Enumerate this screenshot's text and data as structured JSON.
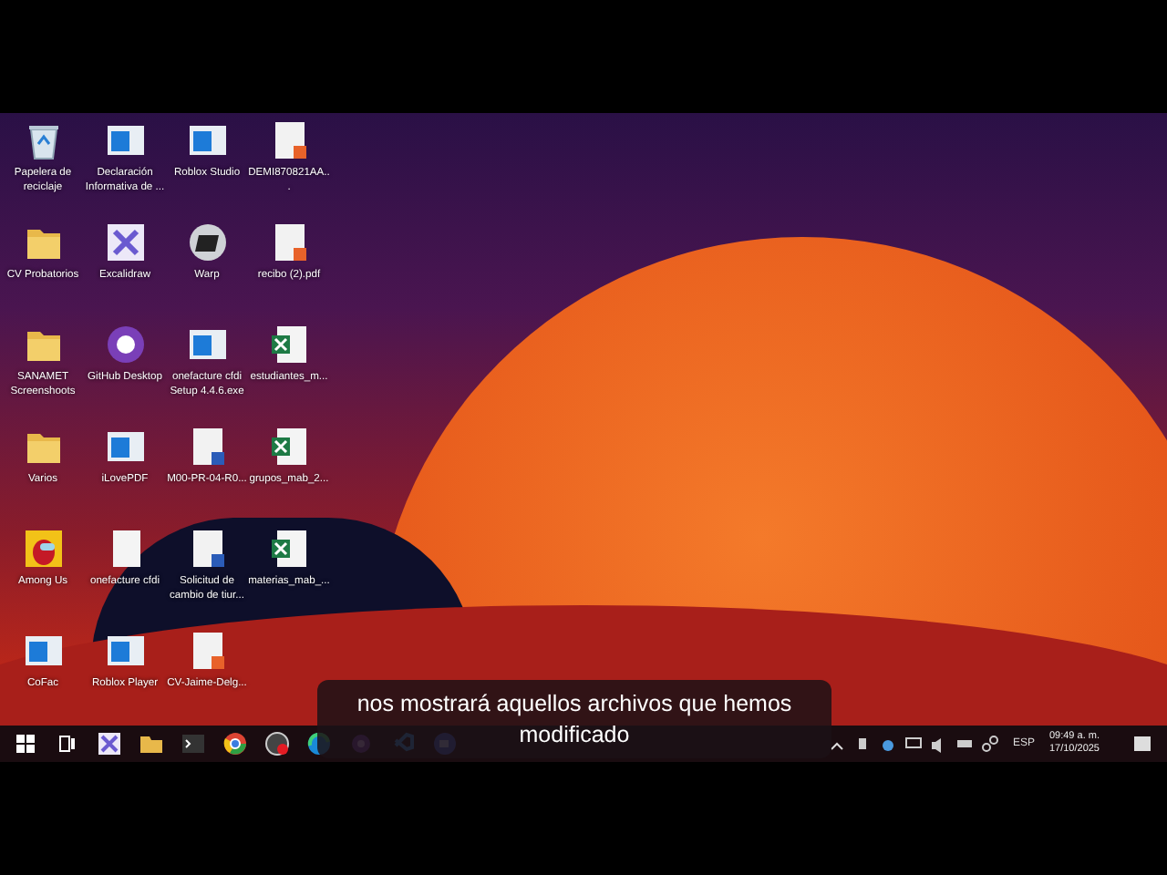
{
  "desktop_icons": [
    {
      "kind": "recycle",
      "label": "Papelera de reciclaje"
    },
    {
      "kind": "app",
      "label": "Declaración Informativa de ..."
    },
    {
      "kind": "app",
      "label": "Roblox Studio"
    },
    {
      "kind": "pdf",
      "label": "DEMI870821AA..."
    },
    {
      "kind": "folder",
      "label": "CV Probatorios"
    },
    {
      "kind": "excalidraw",
      "label": "Excalidraw"
    },
    {
      "kind": "warp",
      "label": "Warp"
    },
    {
      "kind": "pdf",
      "label": "recibo (2).pdf"
    },
    {
      "kind": "folder",
      "label": "SANAMET Screenshoots"
    },
    {
      "kind": "github",
      "label": "GitHub Desktop"
    },
    {
      "kind": "app",
      "label": "onefacture cfdi Setup 4.4.6.exe"
    },
    {
      "kind": "excel",
      "label": "estudiantes_m..."
    },
    {
      "kind": "folder",
      "label": "Varios"
    },
    {
      "kind": "app",
      "label": "iLovePDF"
    },
    {
      "kind": "word",
      "label": "M00-PR-04-R0..."
    },
    {
      "kind": "excel",
      "label": "grupos_mab_2..."
    },
    {
      "kind": "game",
      "label": "Among Us"
    },
    {
      "kind": "blank",
      "label": "onefacture cfdi"
    },
    {
      "kind": "word",
      "label": "Solicitud de cambio de tiur..."
    },
    {
      "kind": "excel",
      "label": "materias_mab_..."
    },
    {
      "kind": "app",
      "label": "CoFac"
    },
    {
      "kind": "app",
      "label": "Roblox Player"
    },
    {
      "kind": "pdf",
      "label": "CV-Jaime-Delg..."
    }
  ],
  "taskbar": {
    "pinned": [
      {
        "kind": "start"
      },
      {
        "kind": "taskview"
      },
      {
        "kind": "excalidraw"
      },
      {
        "kind": "explorer"
      },
      {
        "kind": "terminal"
      },
      {
        "kind": "chrome"
      },
      {
        "kind": "recorder"
      },
      {
        "kind": "edge"
      },
      {
        "kind": "github"
      },
      {
        "kind": "vscode"
      },
      {
        "kind": "zoom"
      }
    ],
    "tray": {
      "language": "ESP",
      "time": "09:49 a. m.",
      "date": "17/10/2025"
    }
  },
  "subtitle": "nos mostrará aquellos archivos que hemos modificado"
}
